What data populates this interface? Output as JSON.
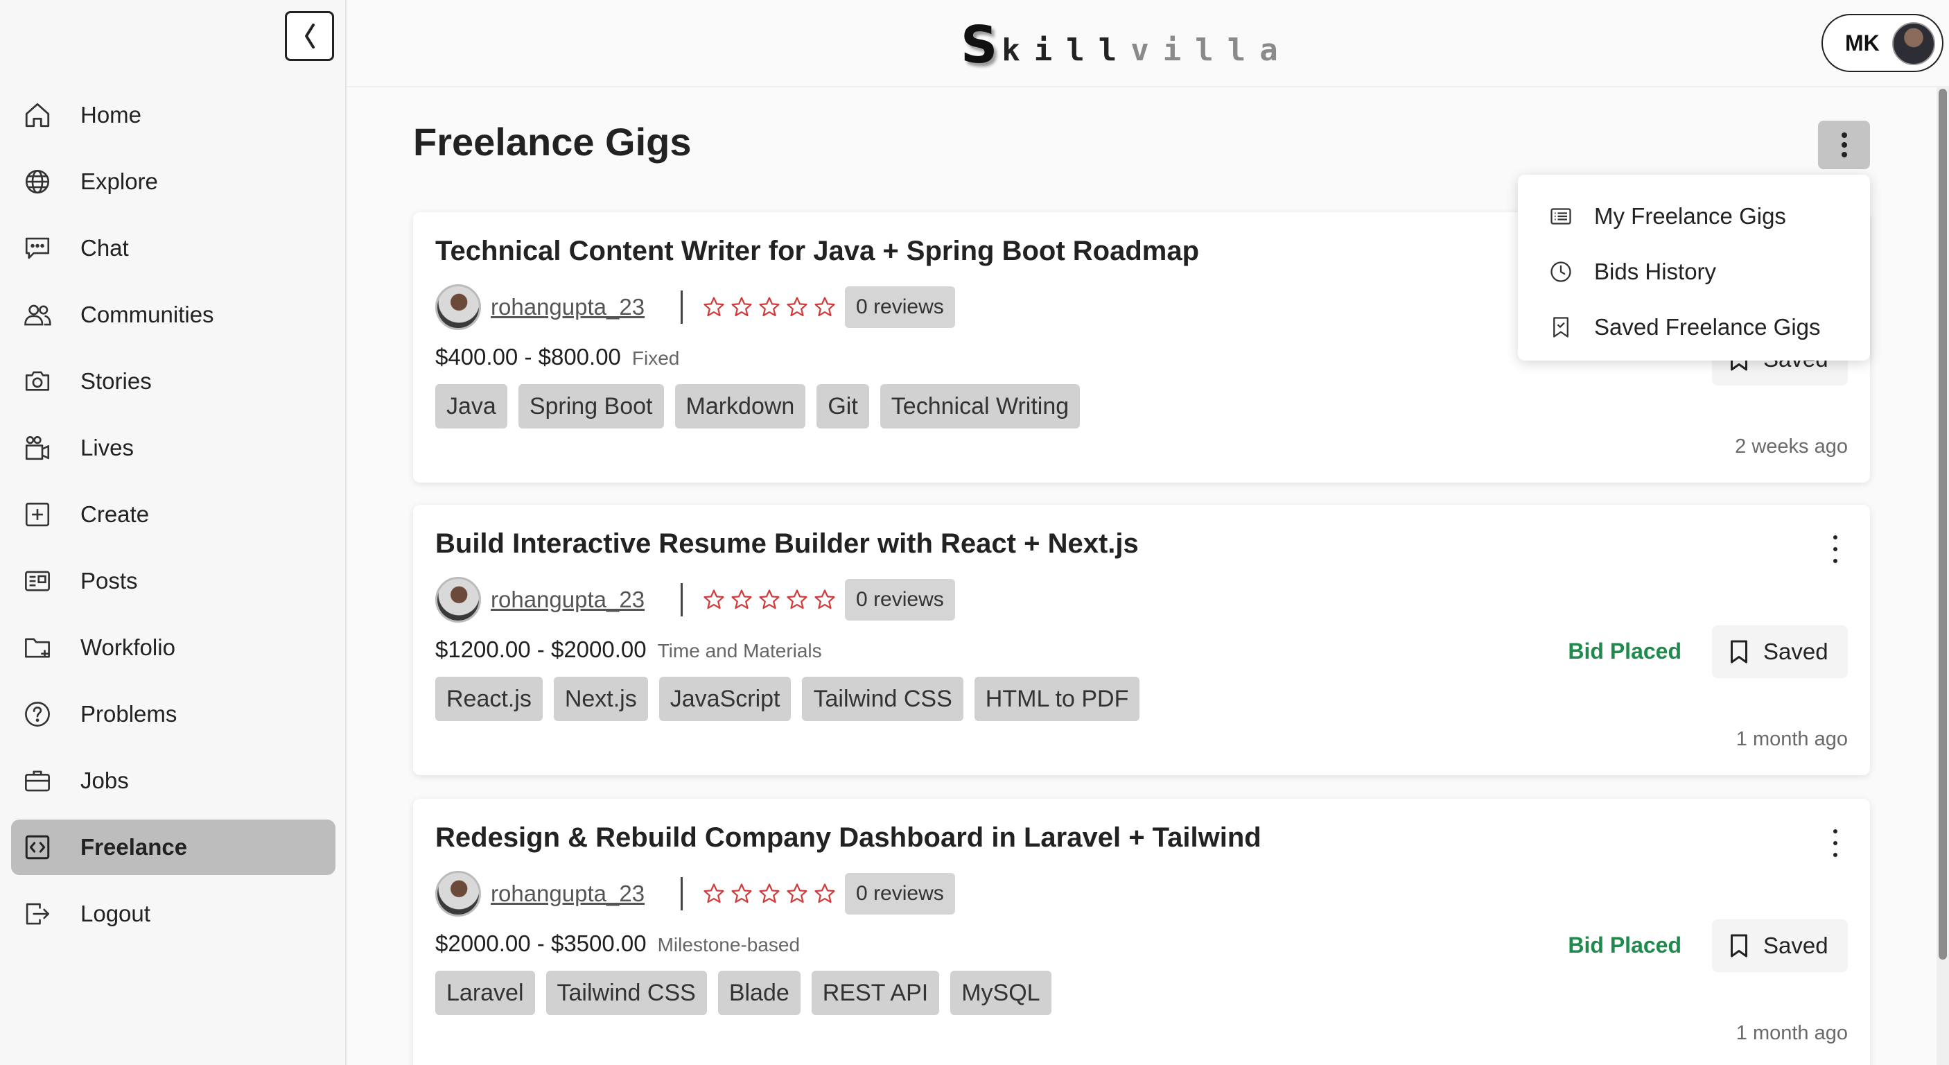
{
  "app": {
    "logo_first": "S",
    "logo_mid": "kill",
    "logo_end": "villa"
  },
  "sidebar": {
    "items": [
      {
        "label": "Home",
        "icon": "home-icon"
      },
      {
        "label": "Explore",
        "icon": "globe-icon"
      },
      {
        "label": "Chat",
        "icon": "chat-icon"
      },
      {
        "label": "Communities",
        "icon": "users-icon"
      },
      {
        "label": "Stories",
        "icon": "camera-icon"
      },
      {
        "label": "Lives",
        "icon": "video-icon"
      },
      {
        "label": "Create",
        "icon": "plus-square-icon"
      },
      {
        "label": "Posts",
        "icon": "newspaper-icon"
      },
      {
        "label": "Workfolio",
        "icon": "folder-plus-icon"
      },
      {
        "label": "Problems",
        "icon": "question-circle-icon"
      },
      {
        "label": "Jobs",
        "icon": "briefcase-icon"
      },
      {
        "label": "Freelance",
        "icon": "code-square-icon",
        "active": true
      },
      {
        "label": "Logout",
        "icon": "logout-icon"
      }
    ]
  },
  "user": {
    "initials": "MK"
  },
  "page": {
    "title": "Freelance Gigs"
  },
  "menu": {
    "items": [
      {
        "label": "My Freelance Gigs",
        "icon": "list-icon"
      },
      {
        "label": "Bids History",
        "icon": "clock-icon"
      },
      {
        "label": "Saved Freelance Gigs",
        "icon": "bookmark-check-icon"
      }
    ]
  },
  "gigs": [
    {
      "title": "Technical Content Writer for Java + Spring Boot Roadmap",
      "author": "rohangupta_23",
      "reviews": "0 reviews",
      "price": "$400.00 - $800.00",
      "price_type": "Fixed",
      "tags": [
        "Java",
        "Spring Boot",
        "Markdown",
        "Git",
        "Technical Writing"
      ],
      "time_ago": "2 weeks ago",
      "saved_label": "Saved"
    },
    {
      "title": "Build Interactive Resume Builder with React + Next.js",
      "author": "rohangupta_23",
      "reviews": "0 reviews",
      "price": "$1200.00 - $2000.00",
      "price_type": "Time and Materials",
      "tags": [
        "React.js",
        "Next.js",
        "JavaScript",
        "Tailwind CSS",
        "HTML to PDF"
      ],
      "time_ago": "1 month ago",
      "status": "Bid Placed",
      "saved_label": "Saved"
    },
    {
      "title": "Redesign & Rebuild Company Dashboard in Laravel + Tailwind",
      "author": "rohangupta_23",
      "reviews": "0 reviews",
      "price": "$2000.00 - $3500.00",
      "price_type": "Milestone-based",
      "tags": [
        "Laravel",
        "Tailwind CSS",
        "Blade",
        "REST API",
        "MySQL"
      ],
      "time_ago": "1 month ago",
      "status": "Bid Placed",
      "saved_label": "Saved"
    }
  ],
  "colors": {
    "bid_placed": "#1f8a4c",
    "star": "#d23b3b",
    "active_nav": "#bdbdbd"
  }
}
